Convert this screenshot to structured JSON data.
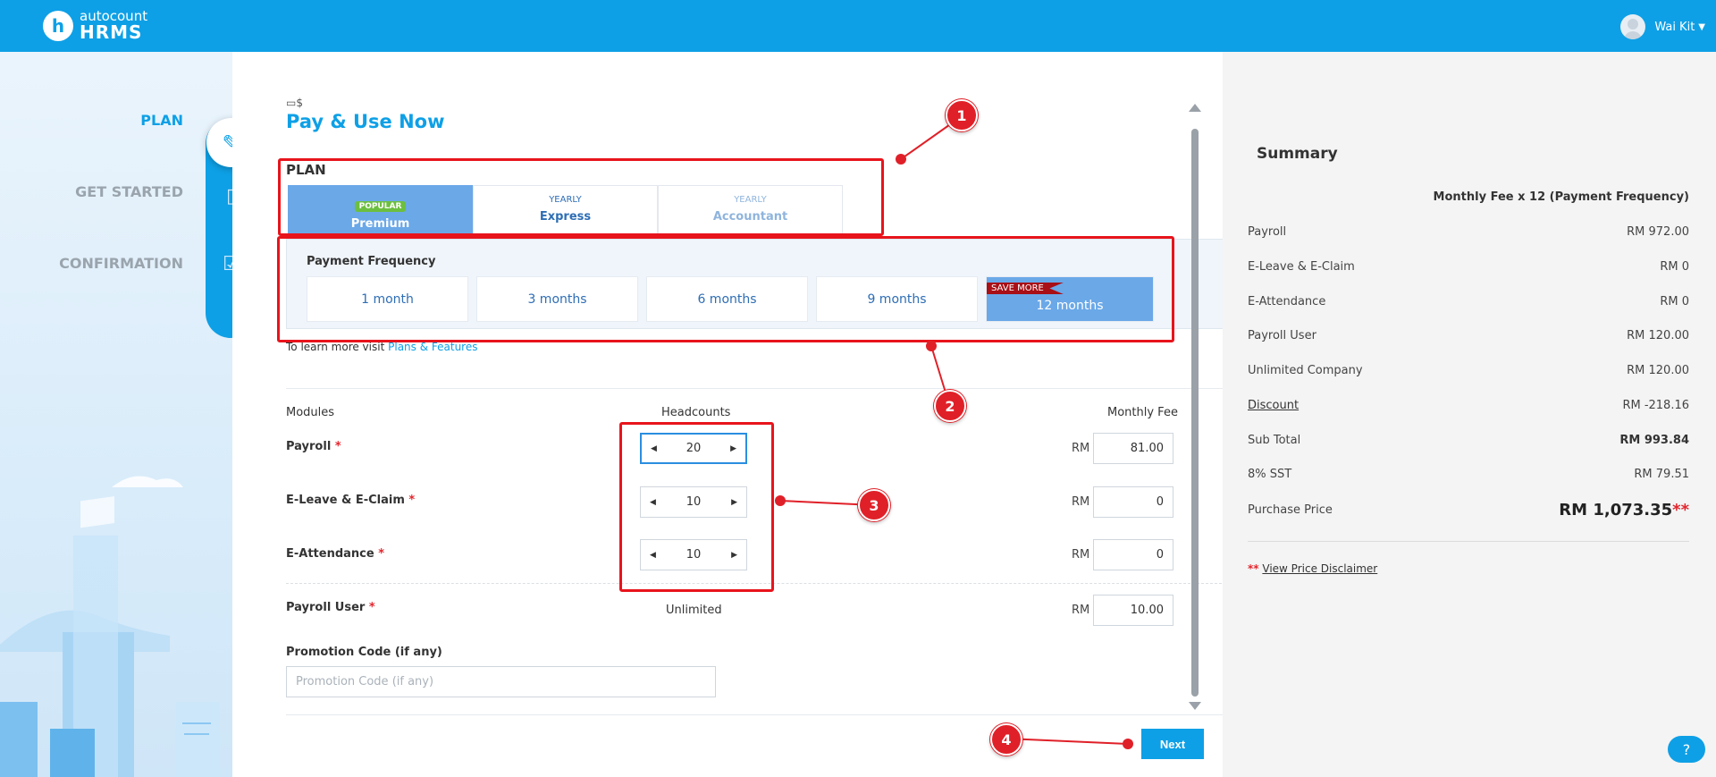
{
  "header": {
    "brand_top": "autocount",
    "brand_bottom": "HRMS",
    "logo_letter": "h",
    "user_name": "Wai Kit"
  },
  "steps": [
    {
      "label": "PLAN",
      "active": true,
      "icon": "edit-document-icon"
    },
    {
      "label": "GET STARTED",
      "active": false,
      "icon": "building-icon"
    },
    {
      "label": "CONFIRMATION",
      "active": false,
      "icon": "checklist-icon"
    }
  ],
  "main": {
    "title": "Pay & Use Now",
    "plan_label": "PLAN",
    "plans": [
      {
        "sub": "POPULAR",
        "name": "Premium",
        "selected": true
      },
      {
        "sub": "YEARLY",
        "name": "Express",
        "selected": false
      },
      {
        "sub": "YEARLY",
        "name": "Accountant",
        "selected": false
      }
    ],
    "frequency_title": "Payment Frequency",
    "frequencies": [
      "1 month",
      "3 months",
      "6 months",
      "9 months",
      "12 months"
    ],
    "save_more": "SAVE MORE",
    "learn_text": "To learn more visit",
    "learn_link": "Plans & Features",
    "columns": {
      "modules": "Modules",
      "headcounts": "Headcounts",
      "monthly_fee": "Monthly Fee"
    },
    "modules": [
      {
        "name": "Payroll",
        "headcount": "20",
        "currency": "RM",
        "fee": "81.00"
      },
      {
        "name": "E-Leave & E-Claim",
        "headcount": "10",
        "currency": "RM",
        "fee": "0"
      },
      {
        "name": "E-Attendance",
        "headcount": "10",
        "currency": "RM",
        "fee": "0"
      },
      {
        "name": "Payroll User",
        "headcount": "Unlimited",
        "currency": "RM",
        "fee": "10.00"
      }
    ],
    "required_mark": "*",
    "promo_label": "Promotion Code (if any)",
    "promo_placeholder": "Promotion Code (if any)",
    "next_label": "Next"
  },
  "summary": {
    "title": "Summary",
    "column_header": "Monthly Fee x 12 (Payment Frequency)",
    "rows": [
      {
        "label": "Payroll",
        "value": "RM 972.00"
      },
      {
        "label": "E-Leave & E-Claim",
        "value": "RM 0"
      },
      {
        "label": "E-Attendance",
        "value": "RM 0"
      },
      {
        "label": "Payroll User",
        "value": "RM 120.00"
      },
      {
        "label": "Unlimited Company",
        "value": "RM 120.00"
      },
      {
        "label": "Discount",
        "value": "RM -218.16"
      },
      {
        "label": "Sub Total",
        "value": "RM 993.84"
      },
      {
        "label": "8% SST",
        "value": "RM 79.51"
      },
      {
        "label": "Purchase Price",
        "value": "RM 1,073.35"
      }
    ],
    "purchase_stars": "**",
    "disclaimer_stars": "**",
    "disclaimer_link": "View Price Disclaimer"
  },
  "annotations": [
    "1",
    "2",
    "3",
    "4"
  ],
  "colors": {
    "accent": "#0ea0e6",
    "selected": "#6aa8e8",
    "annotation": "#e8141c",
    "ribbon": "#a80f16"
  }
}
